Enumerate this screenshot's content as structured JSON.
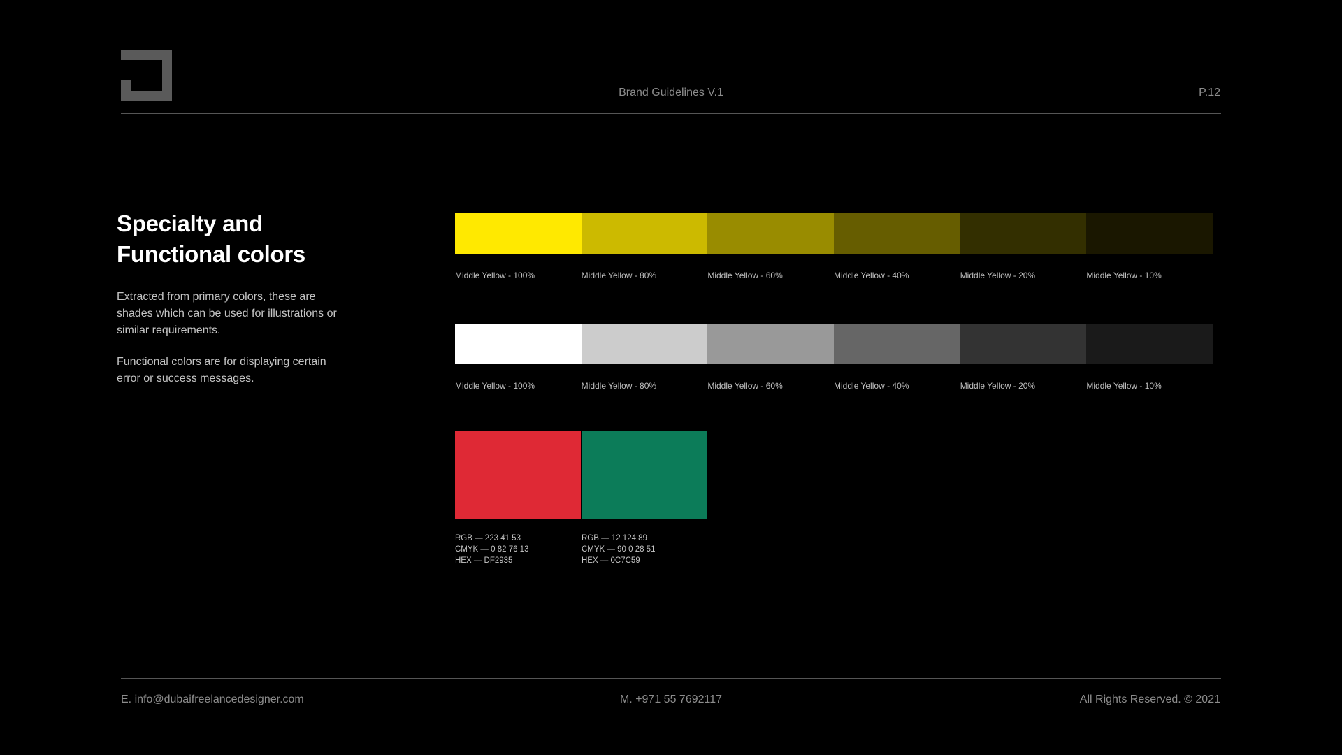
{
  "header": {
    "title": "Brand Guidelines V.1",
    "page": "P.12"
  },
  "intro": {
    "heading_line1": "Specialty and",
    "heading_line2": "Functional colors",
    "paragraph1": "Extracted from primary colors, these are shades which can be used for illustrations or similar requirements.",
    "paragraph2": "Functional colors are for displaying certain error or success messages."
  },
  "yellow_shades": [
    {
      "label": "Middle Yellow - 100%",
      "color": "#FFE900"
    },
    {
      "label": "Middle Yellow - 80%",
      "color": "#CCBA00"
    },
    {
      "label": "Middle Yellow - 60%",
      "color": "#998C00"
    },
    {
      "label": "Middle Yellow - 40%",
      "color": "#665D00"
    },
    {
      "label": "Middle Yellow - 20%",
      "color": "#332F00"
    },
    {
      "label": "Middle Yellow - 10%",
      "color": "#1A1700"
    }
  ],
  "gray_shades": [
    {
      "label": "Middle Yellow - 100%",
      "color": "#FFFFFF"
    },
    {
      "label": "Middle Yellow - 80%",
      "color": "#CCCCCC"
    },
    {
      "label": "Middle Yellow - 60%",
      "color": "#999999"
    },
    {
      "label": "Middle Yellow - 40%",
      "color": "#666666"
    },
    {
      "label": "Middle Yellow - 20%",
      "color": "#333333"
    },
    {
      "label": "Middle Yellow - 10%",
      "color": "#1A1A1A"
    }
  ],
  "functional_colors": [
    {
      "color": "#DF2935",
      "rgb": "RGB — 223 41 53",
      "cmyk": "CMYK — 0 82 76 13",
      "hex": "HEX — DF2935"
    },
    {
      "color": "#0C7C59",
      "rgb": "RGB — 12 124 89",
      "cmyk": "CMYK — 90 0 28 51",
      "hex": "HEX — 0C7C59"
    }
  ],
  "footer": {
    "email": "E. info@dubaifreelancedesigner.com",
    "mobile": "M. +971 55 7692117",
    "rights": "All Rights Reserved. © 2021"
  },
  "logo_color": "#5A5A5A"
}
